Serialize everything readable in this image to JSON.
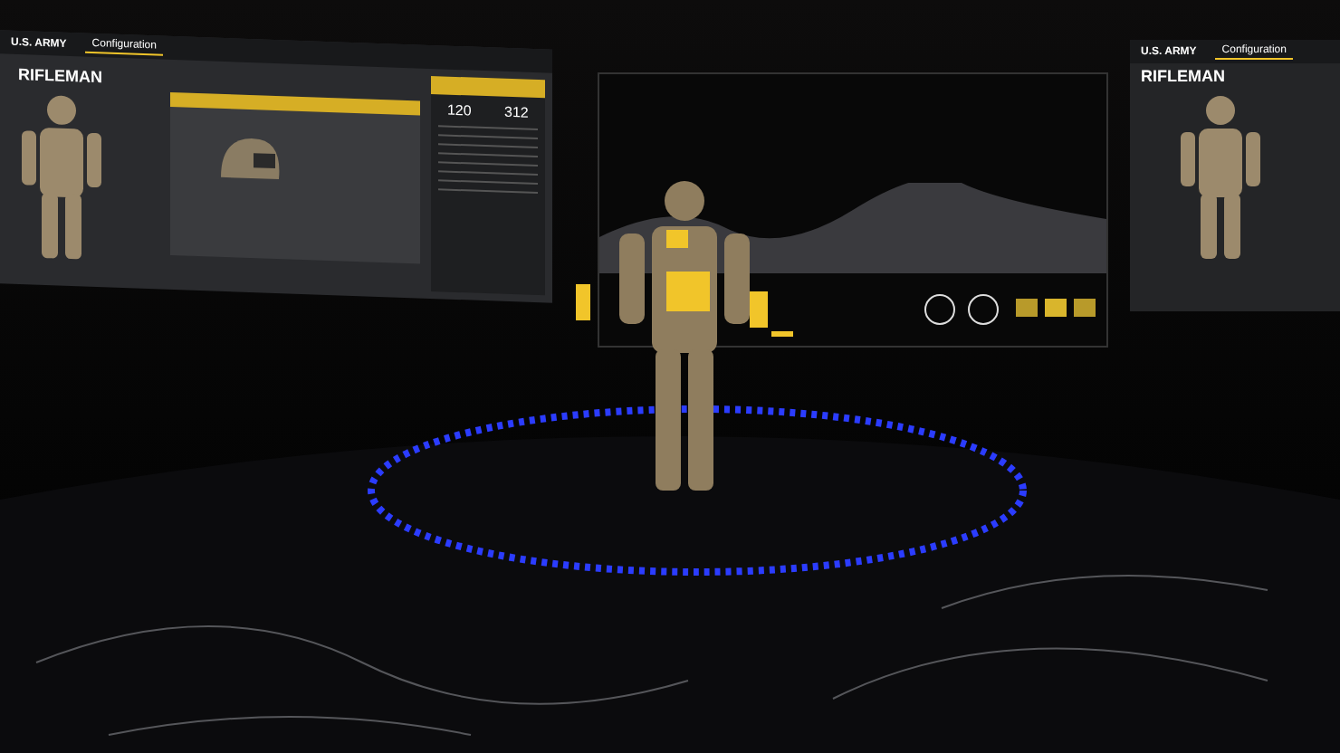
{
  "left_panel": {
    "brand": "U.S. ARMY",
    "tabs": [
      {
        "label": "Configuration",
        "selected": true
      }
    ],
    "title": "RIFLEMAN",
    "stats": [
      "120",
      "312"
    ]
  },
  "right_panel": {
    "brand": "U.S. ARMY",
    "tabs": [
      {
        "label": "Configuration",
        "selected": true
      }
    ],
    "title": "RIFLEMAN"
  }
}
